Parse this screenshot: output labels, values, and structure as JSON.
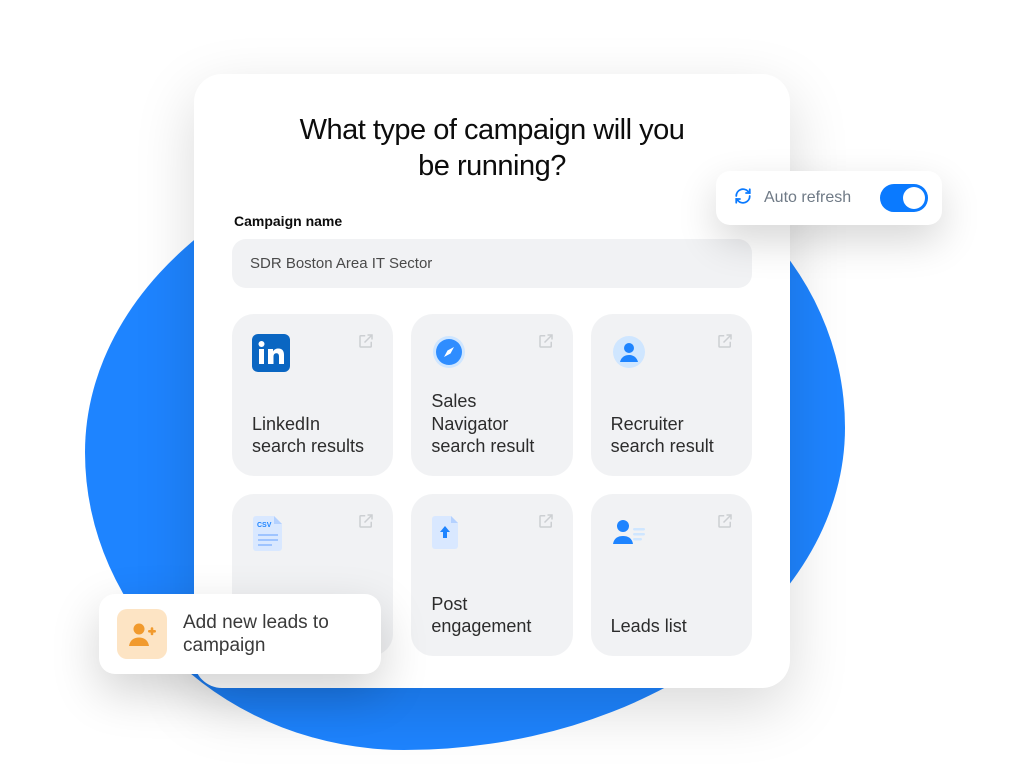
{
  "title": "What type of campaign will you be running?",
  "campaign_name_label": "Campaign name",
  "campaign_name_value": "SDR Boston Area IT Sector",
  "tiles": [
    {
      "label": "LinkedIn search results"
    },
    {
      "label": "Sales Navigator search result"
    },
    {
      "label": "Recruiter search result"
    },
    {
      "label": ""
    },
    {
      "label": "Post engagement"
    },
    {
      "label": "Leads list"
    }
  ],
  "auto_refresh": {
    "label": "Auto refresh",
    "on": true
  },
  "add_leads": {
    "label": "Add new leads to campaign"
  },
  "colors": {
    "accent": "#0a7aff",
    "blob": "#1e84ff",
    "tile_bg": "#f1f2f4",
    "add_leads_icon_bg": "#fde4c4",
    "add_leads_icon_fg": "#f19a2e"
  }
}
